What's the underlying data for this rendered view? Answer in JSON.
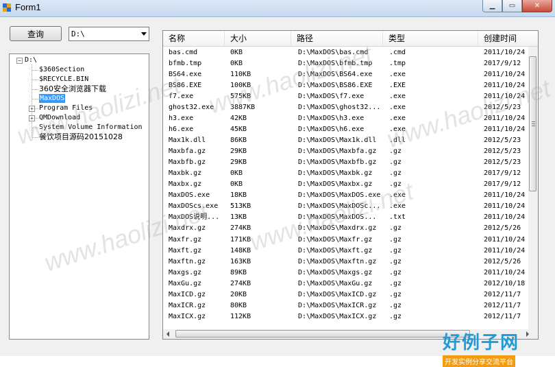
{
  "window": {
    "title": "Form1"
  },
  "toolbar": {
    "query_label": "查询",
    "drive_value": "D:\\"
  },
  "tree": {
    "root": "D:\\",
    "children": [
      {
        "label": "$360Section",
        "expandable": false,
        "cjk": false
      },
      {
        "label": "$RECYCLE.BIN",
        "expandable": false,
        "cjk": false
      },
      {
        "label": "360安全浏览器下载",
        "expandable": false,
        "cjk": true
      },
      {
        "label": "MaxDOS",
        "expandable": false,
        "cjk": false,
        "selected": true
      },
      {
        "label": "Program Files",
        "expandable": true,
        "cjk": false
      },
      {
        "label": "QMDownload",
        "expandable": true,
        "cjk": false
      },
      {
        "label": "System Volume Information",
        "expandable": false,
        "cjk": false
      },
      {
        "label": "餐饮项目源码20151028",
        "expandable": false,
        "cjk": true
      }
    ]
  },
  "list": {
    "columns": [
      "名称",
      "大小",
      "路径",
      "类型",
      "创建时间"
    ],
    "rows": [
      [
        "bas.cmd",
        "0KB",
        "D:\\MaxDOS\\bas.cmd",
        ".cmd",
        "2011/10/24"
      ],
      [
        "bfmb.tmp",
        "0KB",
        "D:\\MaxDOS\\bfmb.tmp",
        ".tmp",
        "2017/9/12"
      ],
      [
        "BS64.exe",
        "110KB",
        "D:\\MaxDOS\\BS64.exe",
        ".exe",
        "2011/10/24"
      ],
      [
        "BS86.EXE",
        "100KB",
        "D:\\MaxDOS\\BS86.EXE",
        ".EXE",
        "2011/10/24"
      ],
      [
        "f7.exe",
        "575KB",
        "D:\\MaxDOS\\f7.exe",
        ".exe",
        "2011/10/24"
      ],
      [
        "ghost32.exe",
        "3887KB",
        "D:\\MaxDOS\\ghost32...",
        ".exe",
        "2012/5/23"
      ],
      [
        "h3.exe",
        "42KB",
        "D:\\MaxDOS\\h3.exe",
        ".exe",
        "2011/10/24"
      ],
      [
        "h6.exe",
        "45KB",
        "D:\\MaxDOS\\h6.exe",
        ".exe",
        "2011/10/24"
      ],
      [
        "Max1k.dll",
        "86KB",
        "D:\\MaxDOS\\Max1k.dll",
        ".dll",
        "2012/5/23"
      ],
      [
        "Maxbfa.gz",
        "29KB",
        "D:\\MaxDOS\\Maxbfa.gz",
        ".gz",
        "2012/5/23"
      ],
      [
        "Maxbfb.gz",
        "29KB",
        "D:\\MaxDOS\\Maxbfb.gz",
        ".gz",
        "2012/5/23"
      ],
      [
        "Maxbk.gz",
        "0KB",
        "D:\\MaxDOS\\Maxbk.gz",
        ".gz",
        "2017/9/12"
      ],
      [
        "Maxbx.gz",
        "0KB",
        "D:\\MaxDOS\\Maxbx.gz",
        ".gz",
        "2017/9/12"
      ],
      [
        "MaxDOS.exe",
        "18KB",
        "D:\\MaxDOS\\MaxDOS.exe",
        ".exe",
        "2011/10/24"
      ],
      [
        "MaxDOScs.exe",
        "513KB",
        "D:\\MaxDOS\\MaxDOSc...",
        ".exe",
        "2011/10/24"
      ],
      [
        "MaxDOS说明...",
        "13KB",
        "D:\\MaxDOS\\MaxDOS...",
        ".txt",
        "2011/10/24"
      ],
      [
        "Maxdrx.gz",
        "274KB",
        "D:\\MaxDOS\\Maxdrx.gz",
        ".gz",
        "2012/5/26"
      ],
      [
        "Maxfr.gz",
        "171KB",
        "D:\\MaxDOS\\Maxfr.gz",
        ".gz",
        "2011/10/24"
      ],
      [
        "Maxft.gz",
        "148KB",
        "D:\\MaxDOS\\Maxft.gz",
        ".gz",
        "2011/10/24"
      ],
      [
        "Maxftn.gz",
        "163KB",
        "D:\\MaxDOS\\Maxftn.gz",
        ".gz",
        "2012/5/26"
      ],
      [
        "Maxgs.gz",
        "89KB",
        "D:\\MaxDOS\\Maxgs.gz",
        ".gz",
        "2011/10/24"
      ],
      [
        "MaxGu.gz",
        "274KB",
        "D:\\MaxDOS\\MaxGu.gz",
        ".gz",
        "2012/10/18"
      ],
      [
        "MaxICD.gz",
        "20KB",
        "D:\\MaxDOS\\MaxICD.gz",
        ".gz",
        "2012/11/7"
      ],
      [
        "MaxICR.gz",
        "80KB",
        "D:\\MaxDOS\\MaxICR.gz",
        ".gz",
        "2012/11/7"
      ],
      [
        "MaxICX.gz",
        "112KB",
        "D:\\MaxDOS\\MaxICX.gz",
        ".gz",
        "2012/11/7"
      ]
    ]
  },
  "watermark": {
    "text": "www.haolizi.net",
    "logo_big": "好例子网",
    "logo_small": "开发实例分享交流平台"
  },
  "icons": [
    "app-icon",
    "minimize-icon",
    "maximize-icon",
    "close-icon",
    "dropdown-arrow-icon",
    "expand-icon",
    "collapse-icon",
    "scroll-left-icon",
    "scroll-right-icon"
  ]
}
